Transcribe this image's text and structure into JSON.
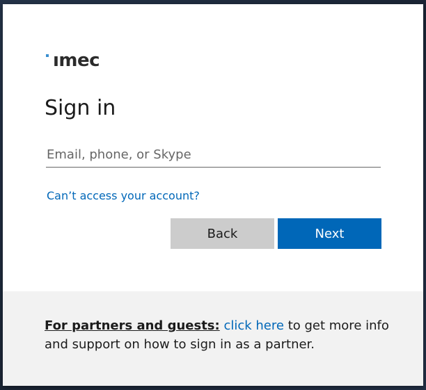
{
  "brand": {
    "logo_text": "ımec",
    "accent_color": "#3a8fd0"
  },
  "signin": {
    "title": "Sign in",
    "email_placeholder": "Email, phone, or Skype",
    "email_value": "",
    "cant_access_link": "Can’t access your account?",
    "back_label": "Back",
    "next_label": "Next",
    "primary_color": "#0067b8",
    "secondary_color": "#cccccc"
  },
  "footer": {
    "strong_text": "For partners and guests:",
    "link_text": "click here",
    "rest_text": " to get more info and support on how to sign in as a partner."
  }
}
